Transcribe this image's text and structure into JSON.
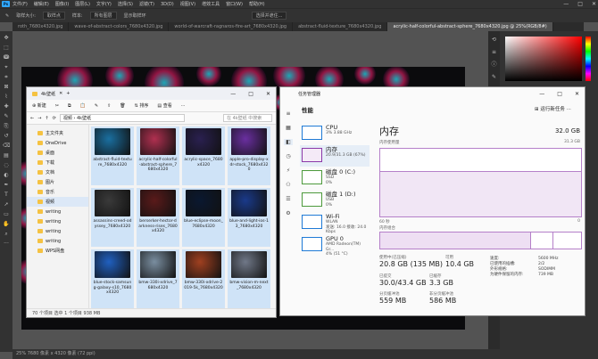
{
  "menubar": {
    "logo": "Ps",
    "items": [
      "文件(F)",
      "编辑(E)",
      "图像(I)",
      "图层(L)",
      "文字(Y)",
      "选择(S)",
      "滤镜(T)",
      "3D(D)",
      "视图(V)",
      "增效工具",
      "窗口(W)",
      "帮助(H)"
    ],
    "controls": [
      "—",
      "□",
      "✕"
    ]
  },
  "options": {
    "sample_label": "取样大小:",
    "sample_value": "取样点",
    "sample2_label": "样本:",
    "sample2_value": "所有图层",
    "show_ring": "显示取样环",
    "select_subject": "选择并遮住..."
  },
  "doc_tabs": [
    "roth_7680x4320.jpg",
    "wave-of-abstract-colors_7680x4320.jpg",
    "world-of-warcraft-ragnaros-fire-art_7680x4320.jpg",
    "abstract-fluid-texture_7680x4320.jpg",
    "acrylic-half-colorful-abstract-sphere_7680x4320.jpg @ 25%(RGB/8#)"
  ],
  "status": "25%  7680 像素 x 4320 像素 (72 ppi)",
  "explorer": {
    "title": "4k壁纸",
    "new_label": "新建",
    "sort_label": "排序",
    "view_label": "查看",
    "address": "视频 › 4k壁纸",
    "search_placeholder": "在 4k壁纸 中搜索",
    "nav": [
      {
        "label": "主文件夹",
        "sel": false
      },
      {
        "label": "OneDrive",
        "sel": false
      },
      {
        "label": "桌面",
        "sel": false
      },
      {
        "label": "下载",
        "sel": false
      },
      {
        "label": "文档",
        "sel": false
      },
      {
        "label": "图片",
        "sel": false
      },
      {
        "label": "音乐",
        "sel": false
      },
      {
        "label": "视频",
        "sel": true
      },
      {
        "label": "writing",
        "sel": false
      },
      {
        "label": "writing",
        "sel": false
      },
      {
        "label": "writing",
        "sel": false
      },
      {
        "label": "writing",
        "sel": false
      },
      {
        "label": "WPS网盘",
        "sel": false
      }
    ],
    "files": [
      {
        "name": "abstract-fluid-texture_7680x4320",
        "color": "#1a6fa0"
      },
      {
        "name": "acrylic-half-colorful-abstract-sphere_7680x4320",
        "color": "#b03050"
      },
      {
        "name": "acrylic-space_7680x4320",
        "color": "#2a2050"
      },
      {
        "name": "apple-pro-display-xdr-stock_7680x4320",
        "color": "#6a2fa0"
      },
      {
        "name": "assassins-creed-odyssey_7680x4320",
        "color": "#3a3a3a"
      },
      {
        "name": "berserker-hector-darkness-rises_7680x4320",
        "color": "#5a1a1a"
      },
      {
        "name": "blue-eclipse-moon_7680x4320",
        "color": "#0a1830"
      },
      {
        "name": "blue-and-light-ios-13_7680x4320",
        "color": "#1a3a8a"
      },
      {
        "name": "blue-stock-samsung-galaxy-s10_7680x4320",
        "color": "#2060c0"
      },
      {
        "name": "bmw-330i-xdrive_7680x4320",
        "color": "#7a8ea0"
      },
      {
        "name": "bmw-330i-xdrive-2019-5k_7680x4320",
        "color": "#a04020"
      },
      {
        "name": "bmw-vision-m-next_7680x4320",
        "color": "#707888"
      }
    ],
    "status_count": "70 个项目",
    "status_sel": "选中 1 个项目",
    "status_size": "938 MB"
  },
  "taskmgr": {
    "title": "任务管理器",
    "heading": "性能",
    "run_task": "运行新任务",
    "resources": [
      {
        "name": "CPU",
        "sub": "3% 3.88 GHz",
        "cls": "",
        "sel": false
      },
      {
        "name": "内存",
        "sub": "20.9/31.3 GB (67%)",
        "cls": "mem",
        "sel": true
      },
      {
        "name": "磁盘 0 (C:)",
        "sub": "SSD\n0%",
        "cls": "disk",
        "sel": false
      },
      {
        "name": "磁盘 1 (D:)",
        "sub": "USB\n0%",
        "cls": "disk",
        "sel": false
      },
      {
        "name": "Wi-Fi",
        "sub": "WLAN\n发送: 16.0 接收: 24.0 Kbps",
        "cls": "",
        "sel": false
      },
      {
        "name": "GPU 0",
        "sub": "AMD Radeon(TM) Gr...\n4% (51 °C)",
        "cls": "",
        "sel": false
      }
    ],
    "memory": {
      "title": "内存",
      "total": "32.0 GB",
      "usage_label": "内存使用量",
      "usage_max": "31.3 GB",
      "time_left": "60 秒",
      "time_right": "0",
      "comp_label": "内存组合",
      "in_use_label": "使用中(已压缩)",
      "in_use": "20.8 GB (135 MB)",
      "available_label": "可用",
      "available": "10.4 GB",
      "committed_label": "已提交",
      "committed": "30.0/43.4 GB",
      "cached_label": "已缓存",
      "cached": "3.3 GB",
      "paged_label": "分页缓冲池",
      "paged": "559 MB",
      "nonpaged_label": "非分页缓冲池",
      "nonpaged": "586 MB",
      "kv": [
        [
          "速度:",
          "5600 MHz"
        ],
        [
          "已使用的插槽:",
          "2/2"
        ],
        [
          "外形规格:",
          "SODIMM"
        ],
        [
          "为硬件保留的内存:",
          "739 MB"
        ]
      ],
      "usage_fraction": 0.67
    }
  }
}
